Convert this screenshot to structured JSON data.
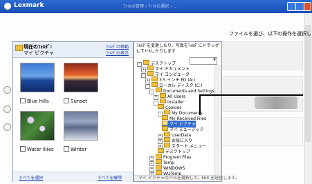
{
  "app": {
    "name": "Lexmark",
    "crumbs": "ﾌｧｲﾙの管理  ›  ﾌｧｲﾙの選択  ›  ..."
  },
  "instruction": "ファイルを選び、以下の操作を選択します",
  "folder_panel": {
    "current_label": "現在のﾌｫﾙﾀﾞ:",
    "folder_name": "マイ ピクチャ",
    "link_change": "ﾌｫﾙﾀﾞの移動",
    "link_view": "ﾌｫﾙﾀﾞの表示",
    "photos": [
      {
        "caption": "Blue hills"
      },
      {
        "caption": "Sunset"
      },
      {
        "caption": "Water lilies"
      },
      {
        "caption": "Winter"
      }
    ],
    "select_all": "すべてを選択",
    "deselect_all": "すべてを解除"
  },
  "drag_panel": {
    "hint": "ﾌｫﾙﾀﾞを変更したり、写真をﾌｫﾙﾀﾞにドラッグしてﾒｰﾙしたりします",
    "tree": [
      {
        "label": "デスクトップ",
        "sign": "-"
      },
      {
        "label": "マイ ドキュメント",
        "sign": "+"
      },
      {
        "label": "マイ コンピュータ",
        "sign": "-"
      },
      {
        "label": "3.5 インチ FD (A:)",
        "sign": "+"
      },
      {
        "label": "ローカル ディスク (C:)",
        "sign": "-"
      },
      {
        "label": "Documents and Settings",
        "sign": "-"
      },
      {
        "label": "All Users",
        "sign": "+"
      },
      {
        "label": "Installer",
        "sign": "-"
      },
      {
        "label": "Cookies",
        "sign": ""
      },
      {
        "label": "My Documents",
        "sign": "-"
      },
      {
        "label": "My Received Files",
        "sign": ""
      },
      {
        "label": "マイ ピクチャ",
        "sign": ""
      },
      {
        "label": "マイ ミュージック",
        "sign": ""
      },
      {
        "label": "UserData",
        "sign": "+"
      },
      {
        "label": "お気に入り",
        "sign": "+"
      },
      {
        "label": "スタート メニュー",
        "sign": "+"
      },
      {
        "label": "デスクトップ",
        "sign": ""
      },
      {
        "label": "Program Files",
        "sign": "+"
      },
      {
        "label": "Temp",
        "sign": "+"
      },
      {
        "label": "WINDOWS",
        "sign": "+"
      },
      {
        "label": "WUTemp",
        "sign": "+"
      }
    ]
  },
  "bottom_note": "マイ ピクチャのﾌｧｲﾙを選択して、FAX を送信します。",
  "colors": {
    "title_bar": "#1a4fb8",
    "selection": "#2e6ad0",
    "link": "#1a3fb0"
  }
}
